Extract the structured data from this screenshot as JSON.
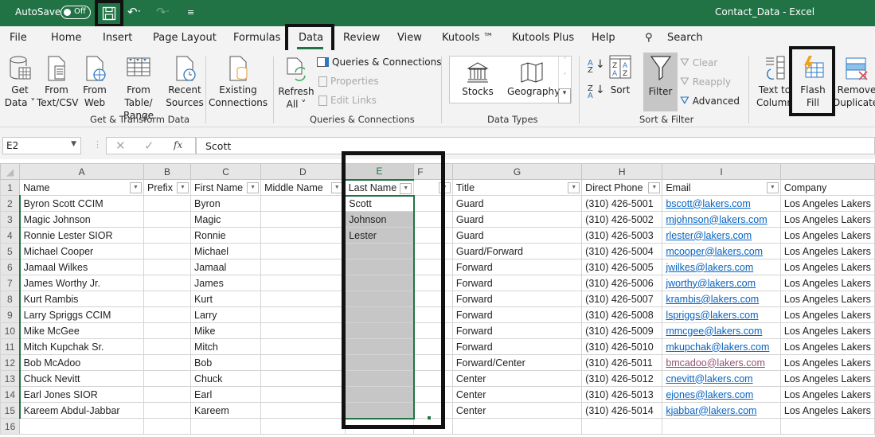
{
  "titlebar": {
    "autosave_label": "AutoSave",
    "autosave_state": "Off",
    "window_title": "Contact_Data  -  Excel"
  },
  "tabs": [
    "File",
    "Home",
    "Insert",
    "Page Layout",
    "Formulas",
    "Data",
    "Review",
    "View",
    "Kutools ™",
    "Kutools Plus",
    "Help"
  ],
  "active_tab": "Data",
  "search_label": "Search",
  "ribbon": {
    "get_transform": {
      "label": "Get & Transform Data",
      "buttons": [
        {
          "line1": "Get",
          "line2": "Data ˅"
        },
        {
          "line1": "From",
          "line2": "Text/CSV"
        },
        {
          "line1": "From",
          "line2": "Web"
        },
        {
          "line1": "From Table/",
          "line2": "Range"
        },
        {
          "line1": "Recent",
          "line2": "Sources"
        },
        {
          "line1": "Existing",
          "line2": "Connections"
        }
      ]
    },
    "queries": {
      "label": "Queries & Connections",
      "refresh_line1": "Refresh",
      "refresh_line2": "All ˅",
      "queries_connections": "Queries & Connections",
      "properties": "Properties",
      "edit_links": "Edit Links"
    },
    "data_types": {
      "label": "Data Types",
      "stocks": "Stocks",
      "geography": "Geography"
    },
    "sort_filter": {
      "label": "Sort & Filter",
      "sort": "Sort",
      "filter": "Filter",
      "clear": "Clear",
      "reapply": "Reapply",
      "advanced": "Advanced"
    },
    "data_tools": {
      "text_to_columns_1": "Text to",
      "text_to_columns_2": "Columns",
      "flash_fill_1": "Flash",
      "flash_fill_2": "Fill",
      "remove_dup_1": "Remove",
      "remove_dup_2": "Duplicates"
    }
  },
  "formula_bar": {
    "name_box": "E2",
    "fx": "fx",
    "formula": "Scott"
  },
  "columns": [
    "A",
    "B",
    "C",
    "D",
    "E",
    "F",
    "G",
    "H",
    "I",
    ""
  ],
  "selected_column": "E",
  "headers": [
    "Name",
    "Prefix",
    "First Name",
    "Middle Name",
    "Last Name",
    "",
    "Title",
    "Direct Phone",
    "Email",
    "Company"
  ],
  "rows": [
    {
      "n": "2",
      "name": "Byron Scott CCIM",
      "first": "Byron",
      "last": "Scott",
      "title": "Guard",
      "phone": "(310) 426-5001",
      "email": "bscott@lakers.com",
      "company": "Los Angeles Lakers"
    },
    {
      "n": "3",
      "name": "Magic Johnson",
      "first": "Magic",
      "last": "Johnson",
      "title": "Guard",
      "phone": "(310) 426-5002",
      "email": "mjohnson@lakers.com",
      "company": "Los Angeles Lakers"
    },
    {
      "n": "4",
      "name": "Ronnie Lester SIOR",
      "first": "Ronnie",
      "last": "Lester",
      "title": "Guard",
      "phone": "(310) 426-5003",
      "email": "rlester@lakers.com",
      "company": "Los Angeles Lakers"
    },
    {
      "n": "5",
      "name": "Michael Cooper",
      "first": "Michael",
      "last": "",
      "title": "Guard/Forward",
      "phone": "(310) 426-5004",
      "email": "mcooper@lakers.com",
      "company": "Los Angeles Lakers"
    },
    {
      "n": "6",
      "name": "Jamaal Wilkes",
      "first": "Jamaal",
      "last": "",
      "title": "Forward",
      "phone": "(310) 426-5005",
      "email": "jwilkes@lakers.com",
      "company": "Los Angeles Lakers"
    },
    {
      "n": "7",
      "name": "James Worthy Jr.",
      "first": "James",
      "last": "",
      "title": "Forward",
      "phone": "(310) 426-5006",
      "email": "jworthy@lakers.com",
      "company": "Los Angeles Lakers"
    },
    {
      "n": "8",
      "name": "Kurt Rambis",
      "first": "Kurt",
      "last": "",
      "title": "Forward",
      "phone": "(310) 426-5007",
      "email": "krambis@lakers.com",
      "company": "Los Angeles Lakers"
    },
    {
      "n": "9",
      "name": "Larry Spriggs CCIM",
      "first": "Larry",
      "last": "",
      "title": "Forward",
      "phone": "(310) 426-5008",
      "email": "lspriggs@lakers.com",
      "company": "Los Angeles Lakers"
    },
    {
      "n": "10",
      "name": "Mike McGee",
      "first": "Mike",
      "last": "",
      "title": "Forward",
      "phone": "(310) 426-5009",
      "email": "mmcgee@lakers.com",
      "company": "Los Angeles Lakers"
    },
    {
      "n": "11",
      "name": "Mitch Kupchak Sr.",
      "first": "Mitch",
      "last": "",
      "title": "Forward",
      "phone": "(310) 426-5010",
      "email": "mkupchak@lakers.com",
      "company": "Los Angeles Lakers"
    },
    {
      "n": "12",
      "name": "Bob McAdoo",
      "first": "Bob",
      "last": "",
      "title": "Forward/Center",
      "phone": "(310) 426-5011",
      "email": "bmcadoo@lakers.com",
      "email_visited": true,
      "company": "Los Angeles Lakers"
    },
    {
      "n": "13",
      "name": "Chuck Nevitt",
      "first": "Chuck",
      "last": "",
      "title": "Center",
      "phone": "(310) 426-5012",
      "email": "cnevitt@lakers.com",
      "company": "Los Angeles Lakers"
    },
    {
      "n": "14",
      "name": "Earl Jones SIOR",
      "first": "Earl",
      "last": "",
      "title": "Center",
      "phone": "(310) 426-5013",
      "email": "ejones@lakers.com",
      "company": "Los Angeles Lakers"
    },
    {
      "n": "15",
      "name": "Kareem Abdul-Jabbar",
      "first": "Kareem",
      "last": "",
      "title": "Center",
      "phone": "(310) 426-5014",
      "email": "kjabbar@lakers.com",
      "company": "Los Angeles Lakers"
    }
  ],
  "empty_row": "16",
  "colors": {
    "excel_green": "#217346",
    "link": "#0563c1",
    "visited_link": "#954f72",
    "fill_selection": "#c6c6c6"
  }
}
